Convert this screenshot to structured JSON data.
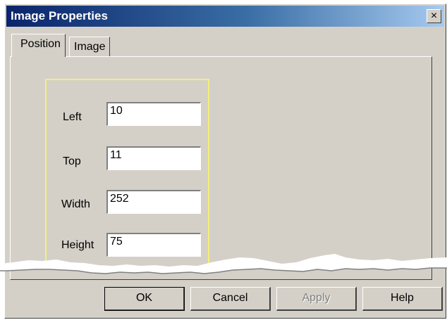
{
  "window": {
    "title": "Image Properties",
    "close_glyph": "×",
    "close_icon": "close-icon"
  },
  "tabs": [
    {
      "label": "Position",
      "active": true
    },
    {
      "label": "Image",
      "active": false
    }
  ],
  "fields": {
    "left": {
      "label": "Left",
      "value": "10"
    },
    "top": {
      "label": "Top",
      "value": "11"
    },
    "width": {
      "label": "Width",
      "value": "252"
    },
    "height": {
      "label": "Height",
      "value": "75"
    }
  },
  "buttons": {
    "ok": "OK",
    "cancel": "Cancel",
    "apply": "Apply",
    "help": "Help"
  },
  "colors": {
    "title_gradient_start": "#0a246a",
    "title_gradient_end": "#a6caf0",
    "dialog_face": "#d4d0c8",
    "highlight": "#f3ef7c"
  }
}
